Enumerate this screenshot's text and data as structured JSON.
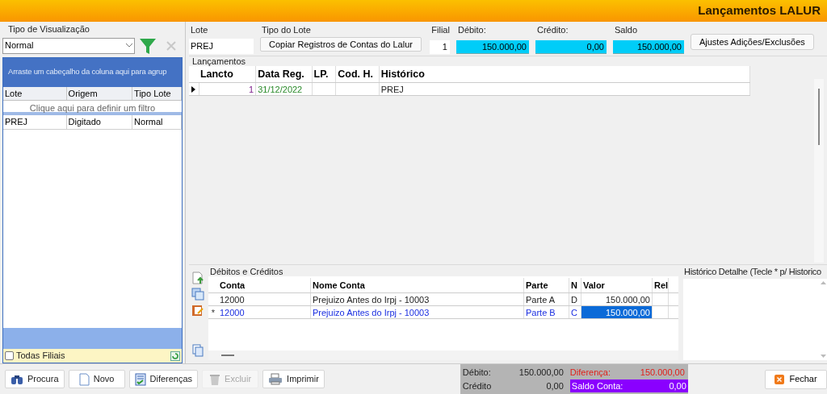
{
  "window": {
    "title": "Lançamentos LALUR"
  },
  "left_panel": {
    "view_label": "Tipo de Visualização",
    "view_select": {
      "value": "Normal"
    },
    "group_hint": "Arraste um cabeçalho da coluna aqui para agrup",
    "columns": [
      "Lote",
      "Origem",
      "Tipo Lote"
    ],
    "filter_hint": "Clique aqui para definir um filtro",
    "rows": [
      {
        "cells": [
          "PREJ",
          "Digitado",
          "Normal"
        ],
        "selected": false
      }
    ],
    "todas_filiais": {
      "label": "Todas Filiais",
      "checked": false
    }
  },
  "header": {
    "lote": {
      "label": "Lote",
      "value": "PREJ"
    },
    "tipo_lote": {
      "label": "Tipo do Lote",
      "button": "Copiar Registros de Contas do Lalur"
    },
    "filial": {
      "label": "Filial",
      "value": "1"
    },
    "debito": {
      "label": "Débito:",
      "value": "150.000,00"
    },
    "credito": {
      "label": "Crédito:",
      "value": "0,00"
    },
    "saldo": {
      "label": "Saldo",
      "value": "150.000,00"
    },
    "ajustes_button": "Ajustes Adições/Exclusões"
  },
  "lancamentos": {
    "title": "Lançamentos",
    "columns": [
      "Lancto",
      "Data Reg.",
      "LP.",
      "Cod. H.",
      "Histórico"
    ],
    "rows": [
      {
        "cells": [
          "1",
          "31/12/2022",
          "",
          "",
          "PREJ"
        ],
        "current": true
      }
    ]
  },
  "debitos_creditos": {
    "title": "Débitos e Créditos",
    "columns": [
      "Conta",
      "Nome Conta",
      "Parte",
      "N",
      "Valor",
      "Rel"
    ],
    "rows": [
      {
        "marker": "",
        "cells": [
          "12000",
          "Prejuizo Antes do Irpj - 10003",
          "Parte A",
          "D",
          "150.000,00",
          ""
        ],
        "selected": false
      },
      {
        "marker": "*",
        "cells": [
          "12000",
          "Prejuizo Antes do Irpj - 10003",
          "Parte B",
          "C",
          "150.000,00",
          ""
        ],
        "selected": true
      }
    ]
  },
  "historico_detalhe": {
    "title": "Histórico Detalhe (Tecle * p/ Historico"
  },
  "buttons": [
    {
      "label": "Procura",
      "kind": "search",
      "disabled": false
    },
    {
      "label": "Novo",
      "kind": "new",
      "disabled": false
    },
    {
      "label": "Diferenças",
      "kind": "check",
      "disabled": false
    },
    {
      "label": "Excluir",
      "kind": "delete",
      "disabled": true
    },
    {
      "label": "Imprimir",
      "kind": "print",
      "disabled": false
    }
  ],
  "totals": {
    "debito": {
      "label": "Débito:",
      "value": "150.000,00"
    },
    "credito": {
      "label": "Crédito",
      "value": "0,00"
    },
    "diferenca": {
      "label": "Diferença:",
      "value": "150.000,00"
    },
    "saldo_conta": {
      "label": "Saldo Conta:",
      "value": "0,00"
    }
  },
  "close_button": "Fechar"
}
